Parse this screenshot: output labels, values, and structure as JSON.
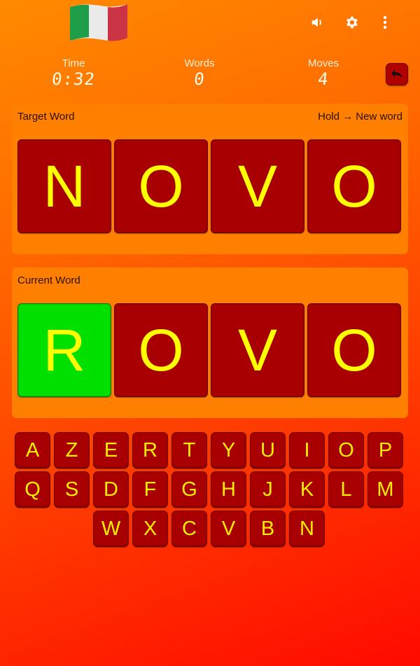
{
  "header": {
    "flag": "italy-flag",
    "icons": [
      "volume-icon",
      "settings-gear-icon",
      "more-vertical-icon"
    ]
  },
  "stats": {
    "time": {
      "label": "Time",
      "value": "0:32"
    },
    "words": {
      "label": "Words",
      "value": "0"
    },
    "moves": {
      "label": "Moves",
      "value": "4"
    },
    "undo_icon": "undo-arrow-icon"
  },
  "target": {
    "label": "Target Word",
    "hint": "Hold → New word",
    "letters": [
      "N",
      "O",
      "V",
      "O"
    ]
  },
  "current": {
    "label": "Current Word",
    "letters": [
      "R",
      "O",
      "V",
      "O"
    ],
    "correct": [
      false,
      true,
      true,
      true
    ]
  },
  "keyboard": {
    "rows": [
      [
        "A",
        "Z",
        "E",
        "R",
        "T",
        "Y",
        "U",
        "I",
        "O",
        "P"
      ],
      [
        "Q",
        "S",
        "D",
        "F",
        "G",
        "H",
        "J",
        "K",
        "L",
        "M"
      ],
      [
        "W",
        "X",
        "C",
        "V",
        "B",
        "N"
      ]
    ]
  },
  "colors": {
    "tile": "#a80000",
    "tile_correct_green": "#00e000",
    "letter": "#ffff00",
    "panel": "#ff8000"
  }
}
